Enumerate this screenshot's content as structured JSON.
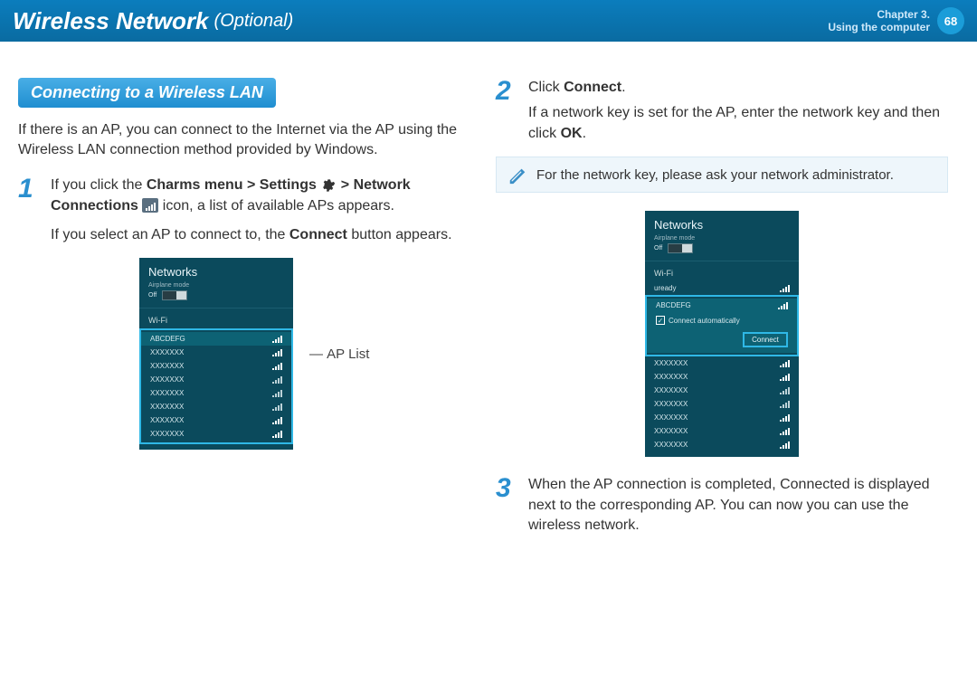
{
  "header": {
    "title_main": "Wireless Network",
    "title_sub": "(Optional)",
    "chapter_line1": "Chapter 3.",
    "chapter_line2": "Using the computer",
    "page_number": "68"
  },
  "left": {
    "section_title": "Connecting to a Wireless LAN",
    "intro": "If there is an AP, you can connect to the Internet via the AP using the Wireless LAN connection method provided by Windows.",
    "step1_num": "1",
    "step1_a": "If you click the ",
    "step1_b1": "Charms menu > Settings",
    "step1_mid": " > ",
    "step1_b2": "Network Connections",
    "step1_c": " icon, a list of available APs appears.",
    "step1_p2a": "If you select an AP to connect to, the ",
    "step1_p2b": "Connect",
    "step1_p2c": " button appears.",
    "callout": "AP List"
  },
  "right": {
    "step2_num": "2",
    "step2_a": "Click ",
    "step2_b": "Connect",
    "step2_c": ".",
    "step2_p2a": "If a network key is set for the AP, enter the network key and then click ",
    "step2_p2b": "OK",
    "step2_p2c": ".",
    "note": "For the network key, please ask your network administrator.",
    "step3_num": "3",
    "step3": "When the AP connection is completed, Connected is displayed next to the corresponding AP. You can now you can use the wireless network."
  },
  "panel": {
    "title": "Networks",
    "airplane": "Airplane mode",
    "off": "Off",
    "wifi": "Wi-Fi",
    "ap_selected": "ABCDEFG",
    "ap_generic": "XXXXXXX",
    "uready": "uready",
    "auto": "Connect automatically",
    "connect": "Connect"
  }
}
